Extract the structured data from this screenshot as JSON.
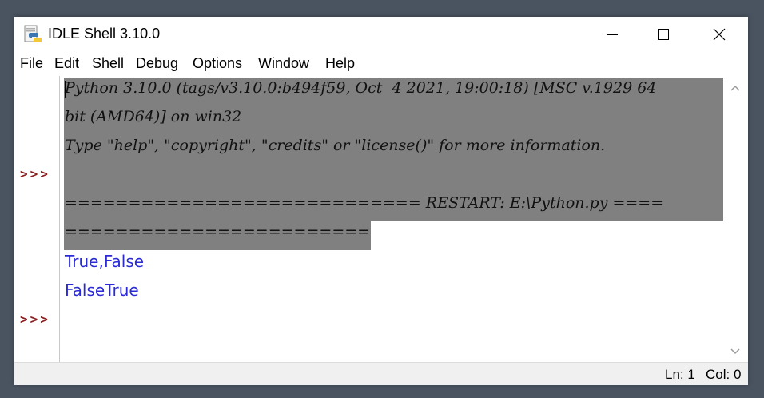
{
  "window": {
    "title": "IDLE Shell 3.10.0"
  },
  "menu": [
    "File",
    "Edit",
    "Shell",
    "Debug",
    "Options",
    "Window",
    "Help"
  ],
  "shell": {
    "prompts": [
      ">>>",
      ">>>"
    ],
    "lines": [
      "Python 3.10.0 (tags/v3.10.0:b494f59, Oct  4 2021, 19:00:18) [MSC v.1929 64",
      "bit (AMD64)] on win32",
      "Type \"help\", \"copyright\", \"credits\" or \"license()\" for more information.",
      "============================ RESTART: E:\\Python.py ====",
      "========================"
    ],
    "output": [
      "True,False",
      "FalseTrue"
    ]
  },
  "status": {
    "line": "Ln: 1",
    "col": "Col: 0"
  },
  "colors": {
    "prompt": "#8b1e1e",
    "output": "#2b2bd6",
    "selection": "#808080"
  }
}
